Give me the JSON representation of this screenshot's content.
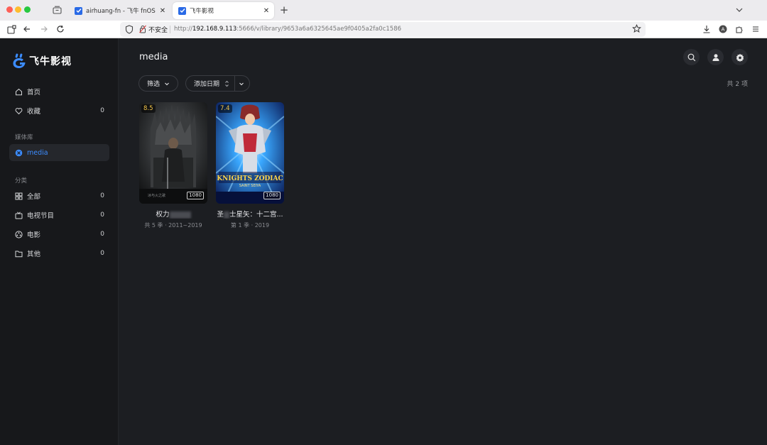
{
  "browser": {
    "tabs": [
      {
        "label": "airhuang-fn - 飞牛 fnOS"
      },
      {
        "label": "飞牛影视"
      }
    ],
    "url": {
      "security_label": "不安全",
      "scheme": "http://",
      "host": "192.168.9.113",
      "rest": ":5666/v/library/9653a6a6325645ae9f0405a2fa0c1586"
    }
  },
  "app": {
    "logo_text": "飞牛影视",
    "nav": {
      "home": {
        "label": "首页"
      },
      "favorites": {
        "label": "收藏",
        "count": "0"
      }
    },
    "library_section": "媒体库",
    "libraries": [
      {
        "label": "media"
      }
    ],
    "category_section": "分类",
    "categories": [
      {
        "label": "全部",
        "count": "0",
        "icon": "grid-icon"
      },
      {
        "label": "电视节目",
        "count": "0",
        "icon": "tv-icon"
      },
      {
        "label": "电影",
        "count": "0",
        "icon": "film-reel-icon"
      },
      {
        "label": "其他",
        "count": "0",
        "icon": "folder-icon"
      }
    ]
  },
  "main": {
    "title": "media",
    "filter_label": "筛选",
    "sort_label": "添加日期",
    "count_text": "共 2 项",
    "items": [
      {
        "title": "权力",
        "rating": "8.5",
        "quality": "1080",
        "subtitle": "共 5 季 · 2011~2019"
      },
      {
        "title_prefix": "圣",
        "title": "士星矢：十二宫...",
        "rating": "7.4",
        "quality": "1080",
        "subtitle": "第 1 季 · 2019"
      }
    ]
  },
  "colors": {
    "accent": "#3c8cff",
    "app_background": "#1c1e22",
    "sidebar_background": "#17181b",
    "rating": "#f5c64a"
  }
}
